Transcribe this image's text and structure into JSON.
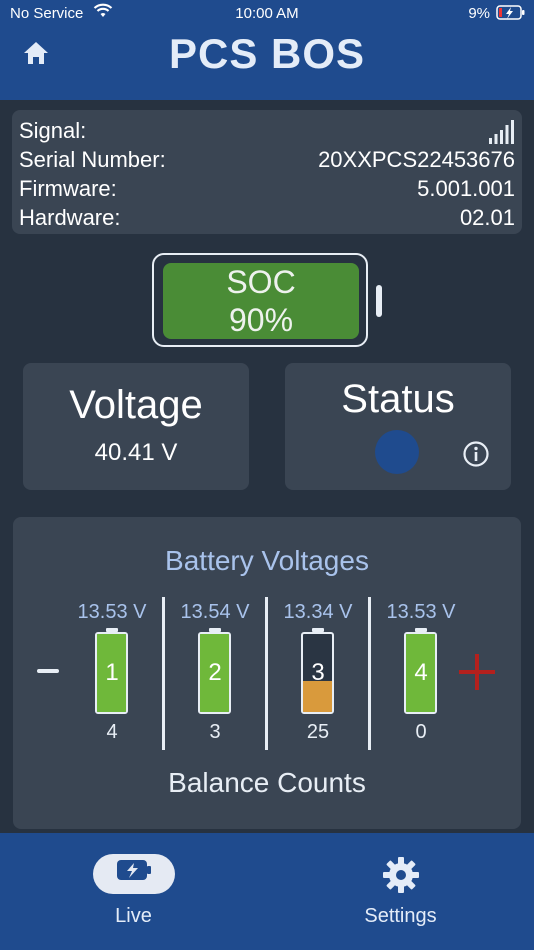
{
  "status_bar": {
    "carrier": "No Service",
    "time": "10:00 AM",
    "battery": "9%"
  },
  "header": {
    "title": "PCS BOS"
  },
  "device_info": {
    "signal_label": "Signal:",
    "serial_label": "Serial Number:",
    "serial_value": "20XXPCS22453676",
    "firmware_label": "Firmware:",
    "firmware_value": "5.001.001",
    "hardware_label": "Hardware:",
    "hardware_value": "02.01"
  },
  "soc": {
    "label": "SOC",
    "value": "90%",
    "level": 0.9,
    "color": "#4a8c36"
  },
  "voltage": {
    "label": "Voltage",
    "value": "40.41 V"
  },
  "status": {
    "label": "Status",
    "indicator_color": "#1f4b8e"
  },
  "battery_voltages": {
    "title": "Battery Voltages",
    "footer": "Balance Counts",
    "cells": [
      {
        "voltage": "13.53 V",
        "number": "1",
        "balance_count": "4",
        "level": 1.0,
        "color": "#6fb83a"
      },
      {
        "voltage": "13.54 V",
        "number": "2",
        "balance_count": "3",
        "level": 1.0,
        "color": "#6fb83a"
      },
      {
        "voltage": "13.34 V",
        "number": "3",
        "balance_count": "25",
        "level": 0.4,
        "color": "#d99a3c"
      },
      {
        "voltage": "13.53 V",
        "number": "4",
        "balance_count": "0",
        "level": 1.0,
        "color": "#6fb83a"
      }
    ]
  },
  "tabs": [
    {
      "label": "Live",
      "icon": "battery-charging-icon",
      "active": true
    },
    {
      "label": "Settings",
      "icon": "gear-icon",
      "active": false
    }
  ]
}
